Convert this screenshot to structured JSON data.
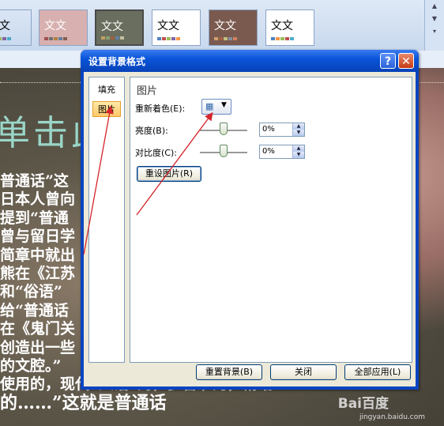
{
  "ribbon": {
    "thumbnails": [
      {
        "label": "文文",
        "bg": "#ffffff",
        "fg": "#333333"
      },
      {
        "label": "文文",
        "bg": "#d8b0b0",
        "fg": "#ffffff"
      },
      {
        "label": "文文",
        "bg": "#6a6e5e",
        "fg": "#ffffff"
      },
      {
        "label": "文文",
        "bg": "#ffffff",
        "fg": "#333333"
      },
      {
        "label": "文文",
        "bg": "#7a5a4e",
        "fg": "#ffffff"
      },
      {
        "label": "文文",
        "bg": "#ffffff",
        "fg": "#333333"
      }
    ]
  },
  "slide": {
    "title_fragment": "单击此",
    "body_lines": [
      "普通话”这                                              经去",
      "日本人曾向                                              在该",
      "提到“普通                                              留学",
      "曾与留日学                                              简章",
      "简章中就出                                              字的",
      "熊在《江苏                                              )、",
      "和“俗语”                                              ，而",
      "给“普通话                                              十年",
      "在《鬼门关                                              务，",
      "创造出一些                                              现代",
      "的文腔。”                                              国各",
      "使用的，现代“人话”的，多音节的，精结"
    ],
    "last_line": "的……”这就是普通话",
    "watermark": "jingyan.baidu.com",
    "watermark_logo": "Bai百度"
  },
  "dialog": {
    "title": "设置背景格式",
    "help_label": "?",
    "close_label": "✕",
    "nav": [
      {
        "label": "填充"
      },
      {
        "label": "图片"
      }
    ],
    "section_title": "图片",
    "recolor_label": "重新着色(E):",
    "brightness_label": "亮度(B):",
    "brightness_value": "0%",
    "contrast_label": "对比度(C):",
    "contrast_value": "0%",
    "reset_picture": "重设图片(R)",
    "reset_background": "重置背景(B)",
    "close_button": "关闭",
    "apply_all": "全部应用(L)"
  },
  "colors": {
    "annotation_red": "#d4242a",
    "dialog_blue": "#0a55d8",
    "nav_active": "#ffc86a"
  }
}
